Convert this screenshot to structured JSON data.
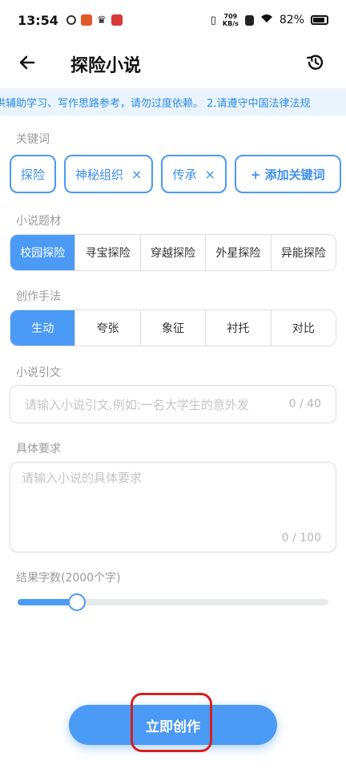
{
  "status": {
    "time": "13:54",
    "net_speed_top": "709",
    "net_speed_bottom": "KB/s",
    "battery": "82%"
  },
  "appbar": {
    "title": "探险小说"
  },
  "notice": "供辅助学习、写作思路参考，请勿过度依赖。 2.请遵守中国法律法规",
  "keywords": {
    "label": "关键词",
    "chips": [
      "探险",
      "神秘组织",
      "传承"
    ],
    "remove_glyph": "×",
    "add_label": "+ 添加关键词"
  },
  "theme": {
    "label": "小说题材",
    "options": [
      "校园探险",
      "寻宝探险",
      "穿越探险",
      "外星探险",
      "异能探险"
    ],
    "selected": "校园探险"
  },
  "technique": {
    "label": "创作手法",
    "options": [
      "生动",
      "夸张",
      "象征",
      "衬托",
      "对比"
    ],
    "selected": "生动"
  },
  "intro": {
    "label": "小说引文",
    "placeholder": "请输入小说引文,例如:一名大学生的意外发",
    "counter": "0 / 40"
  },
  "requirements": {
    "label": "具体要求",
    "placeholder": "请输入小说的具体要求",
    "counter": "0 / 100"
  },
  "word_count": {
    "label": "结果字数(2000个字)",
    "fraction": 0.19
  },
  "create_button": "立即创作",
  "colors": {
    "accent": "#4b9af5",
    "highlight": "#d42020"
  }
}
